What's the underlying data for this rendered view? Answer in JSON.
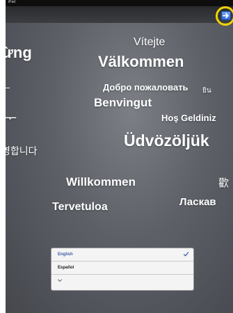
{
  "status_bar": {
    "device_label": "iPad"
  },
  "next_button": {
    "icon": "arrow-right-icon",
    "highlight_color": "#f0d400",
    "button_color": "#2f66d2"
  },
  "welcome_words": {
    "czech": "Vítejte",
    "swedish": "Välkommen",
    "russian": "Добро пожаловать",
    "thai_partial": "ยิน",
    "catalan": "Benvingut",
    "turkish_partial": "Hoş Geldiniz",
    "hungarian": "Üdvözöljük",
    "german": "Willkommen",
    "chinese_partial": "歡",
    "finnish": "Tervetuloa",
    "russian_partial": "Ласкав",
    "vietnamese_partial": "ừng",
    "left_partial_1": "ᆫ",
    "left_partial_2": "ᅮ",
    "korean_partial": "영합니다"
  },
  "language_list": {
    "items": [
      {
        "label": "English",
        "selected": true
      },
      {
        "label": "Español",
        "selected": false
      },
      {
        "label": "",
        "more": true
      }
    ],
    "selected_color": "#3b5fa8"
  }
}
